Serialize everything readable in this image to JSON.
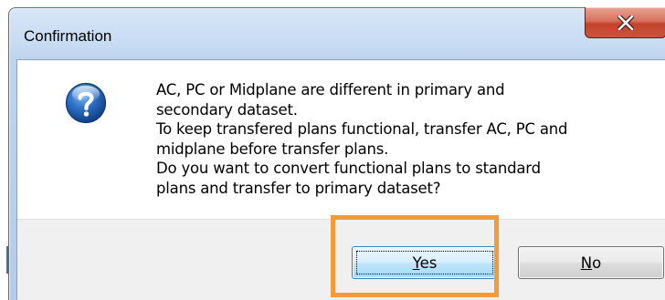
{
  "window": {
    "title": "Confirmation",
    "close_icon": "close-icon"
  },
  "dialog": {
    "icon": "question-icon",
    "message_lines": [
      "AC, PC or Midplane are different in primary and",
      "secondary dataset.",
      "To keep transfered plans functional, transfer AC, PC and",
      "midplane before transfer plans.",
      "Do you want to convert functional plans to standard",
      "plans and transfer to primary dataset?"
    ]
  },
  "buttons": {
    "yes_label": "Yes",
    "no_label": "No"
  },
  "colors": {
    "highlight": "#f39a3a",
    "close_button": "#c4432d",
    "question_icon": "#1f5fa8"
  }
}
